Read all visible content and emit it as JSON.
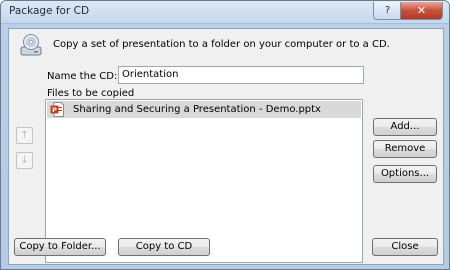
{
  "window": {
    "title": "Package for CD",
    "help_glyph": "?",
    "close_glyph": "✕"
  },
  "description": "Copy a set of presentation to a folder on your computer or to a CD.",
  "name_field": {
    "label": "Name the CD:",
    "value": "Orientation"
  },
  "files": {
    "label": "Files to be copied",
    "items": [
      {
        "name": "Sharing and Securing a Presentation - Demo.pptx",
        "icon": "powerpoint-file-icon",
        "selected": true
      }
    ]
  },
  "move_buttons": {
    "up": "↑",
    "down": "↓"
  },
  "buttons": {
    "add": "Add...",
    "remove": "Remove",
    "options": "Options...",
    "copy_to_folder": "Copy to Folder...",
    "copy_to_cd": "Copy to CD",
    "close": "Close"
  },
  "icons": {
    "header": "cd-icon",
    "move_up": "arrow-up-icon",
    "move_down": "arrow-down-icon"
  },
  "colors": {
    "selection": "#d9d9d9",
    "powerpoint": "#c43e1c",
    "close_button": "#c7513a"
  }
}
